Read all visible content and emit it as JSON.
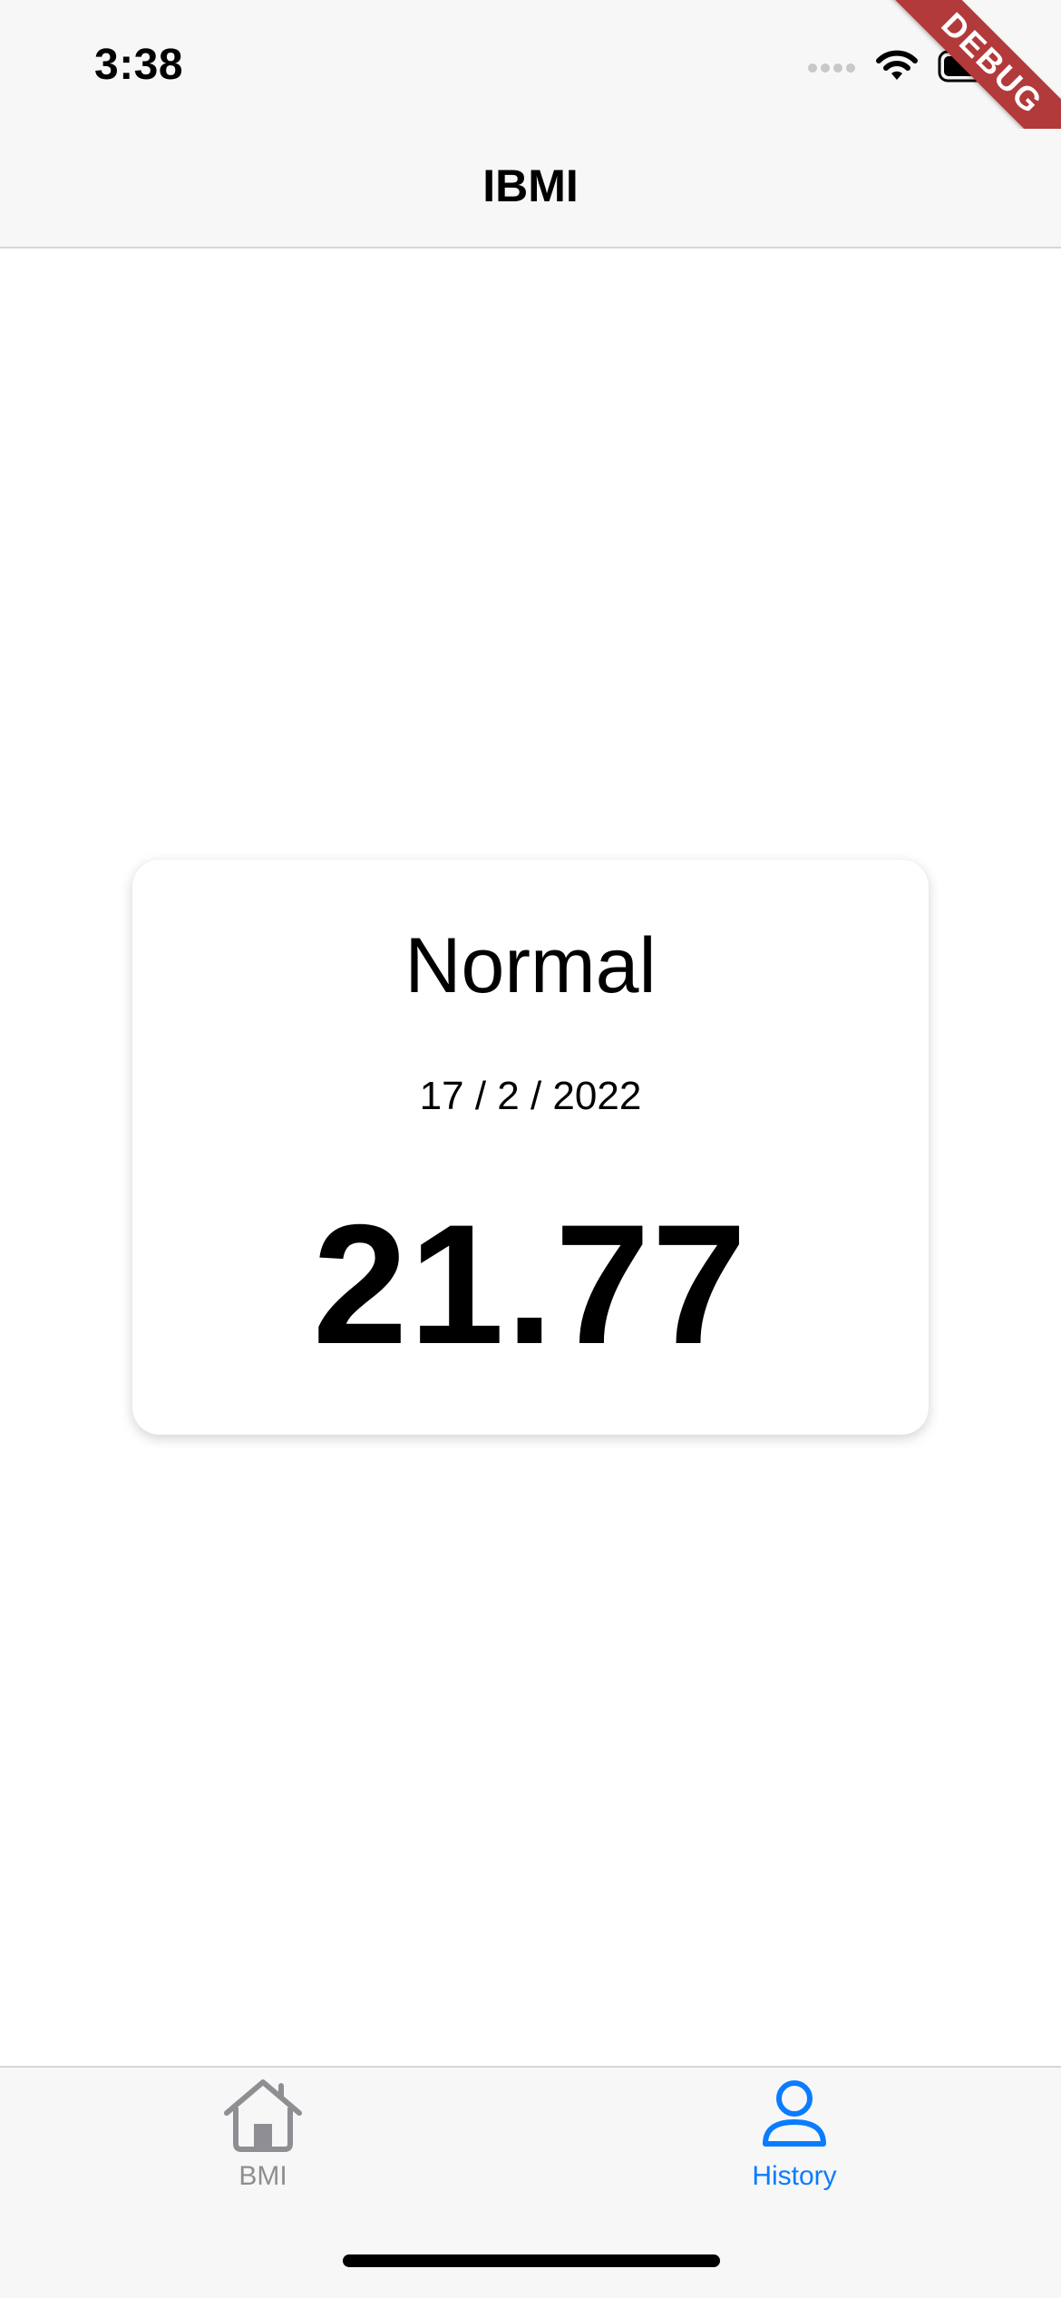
{
  "status_bar": {
    "time": "3:38",
    "icons": [
      "signal-icon",
      "wifi-icon",
      "battery-icon"
    ]
  },
  "debug_banner": "DEBUG",
  "nav": {
    "title": "IBMI"
  },
  "record": {
    "category": "Normal",
    "date": "17 / 2 / 2022",
    "bmi_value": "21.77"
  },
  "tabs": [
    {
      "label": "BMI",
      "icon": "home-icon",
      "active": false
    },
    {
      "label": "History",
      "icon": "person-icon",
      "active": true
    }
  ],
  "colors": {
    "accent": "#0a7cff",
    "inactive": "#8e8e93",
    "bar_background": "#f7f7f7",
    "debug_ribbon": "#b33a3a"
  }
}
